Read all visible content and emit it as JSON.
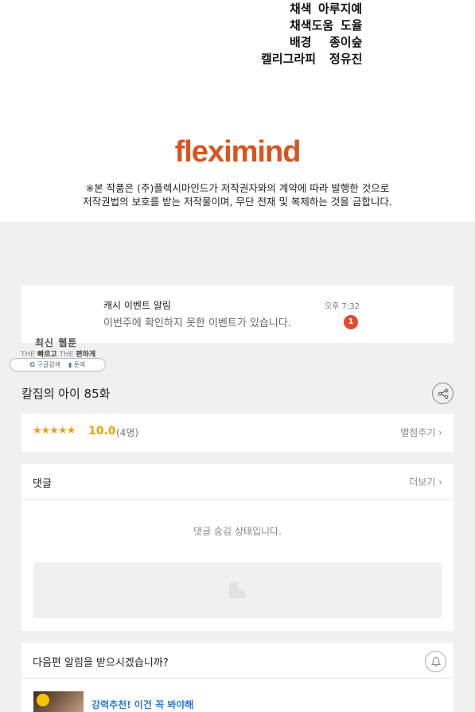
{
  "credits": [
    {
      "role": "채색",
      "name": "아루지예"
    },
    {
      "role": "채색도움",
      "name": "도율"
    },
    {
      "role": "배경",
      "name": "종이숲"
    },
    {
      "role": "캘리그라피",
      "name": "정유진"
    }
  ],
  "publisher": {
    "logo": "fleximind",
    "notice_line1": "※본 작품은 (주)플렉시마인드가 저작권자와의 계약에 따라 발행한 것으로",
    "notice_line2": "저작권법의 보호를 받는 저작물이며, 무단 전재 및 복제하는 것을 금합니다."
  },
  "notification": {
    "title": "캐시 이벤트 알림",
    "time": "오후 7:32",
    "body": "이번주에 확인하지 못한 이벤트가 있습니다.",
    "badge": "1"
  },
  "ad": {
    "title": "최신 웹툰",
    "tag_the1": "THE",
    "tag_fast": "빠르고",
    "tag_the2": "THE",
    "tag_easy": "편하게",
    "google": "구글검색",
    "brand": "툰북"
  },
  "episode": {
    "title": "칼집의 아이 85화"
  },
  "rating": {
    "stars": "★★★★★",
    "score": "10.0",
    "count": "(4명)",
    "rate_link": "별점주기 ›"
  },
  "comments": {
    "title": "댓글",
    "more": "더보기 ›",
    "hidden_message": "댓글 숨김 상태입니다."
  },
  "next_episode": {
    "question": "다음편 알림을 받으시겠습니까?",
    "recommend": "강력추천! 이건 꼭 봐야해"
  },
  "colors": {
    "logo": "#d9531e",
    "badge": "#e8492d",
    "star": "#f2a100",
    "link": "#2b7bd6"
  }
}
